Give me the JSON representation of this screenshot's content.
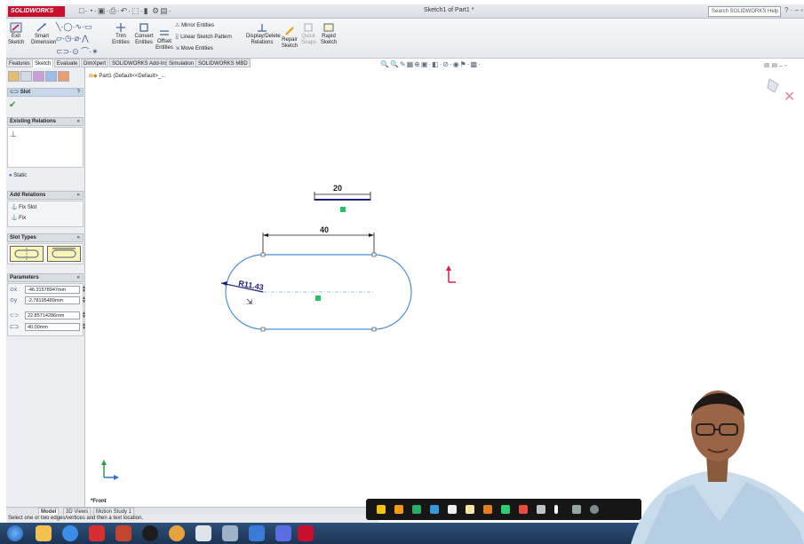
{
  "app": {
    "brand": "SOLIDWORKS",
    "window_title": "Sketch1 of Part1 *",
    "search_placeholder": "Search SOLIDWORKS Help"
  },
  "ribbon": {
    "exit_sketch": "Exit Sketch",
    "smart_dimension": "Smart Dimension",
    "trim_entities": "Trim Entities",
    "convert_entities": "Convert Entities",
    "offset_entities": "Offset Entities",
    "mirror_entities": "Mirror Entities",
    "linear_sketch_pattern": "Linear Sketch Pattern",
    "move_entities": "Move Entities",
    "display_delete_relations": "Display/Delete Relations",
    "repair_sketch": "Repair Sketch",
    "quick_snaps": "Quick Snaps",
    "rapid_sketch": "Rapid Sketch"
  },
  "command_tabs": [
    "Features",
    "Sketch",
    "Evaluate",
    "DimXpert",
    "SOLIDWORKS Add-Ins",
    "Simulation",
    "SOLIDWORKS MBD"
  ],
  "active_command_tab": "Sketch",
  "property_manager": {
    "title": "Slot",
    "existing_relations": {
      "header": "Existing Relations",
      "status": "Static"
    },
    "add_relations": {
      "header": "Add Relations",
      "items": [
        "Fix Slot",
        "Fix"
      ]
    },
    "slot_types": {
      "header": "Slot Types"
    },
    "parameters": {
      "header": "Parameters",
      "center_x": "-46.31578947mm",
      "center_y": "-2.78195489mm",
      "radius": "22.85714286mm",
      "length": "40.00mm"
    }
  },
  "feature_tree": {
    "root": "Part1 (Default<<Default>_..."
  },
  "sketch": {
    "dim_top": "20",
    "dim_length": "40",
    "dim_radius": "R11.43"
  },
  "view_label": "*Front",
  "bottom_tabs": [
    "Model",
    "3D Views",
    "Motion Study 1"
  ],
  "active_bottom_tab": "Model",
  "status_text": "Select one or two edges/vertices and then a text location.",
  "colors": {
    "slot_outline": "#4a90d9",
    "dimension_line": "#1a1a1a",
    "selected_dim": "#1a1f7a",
    "center_point": "#22c55e",
    "origin_arrow": "#e11d48",
    "brand_red": "#c8102e"
  }
}
